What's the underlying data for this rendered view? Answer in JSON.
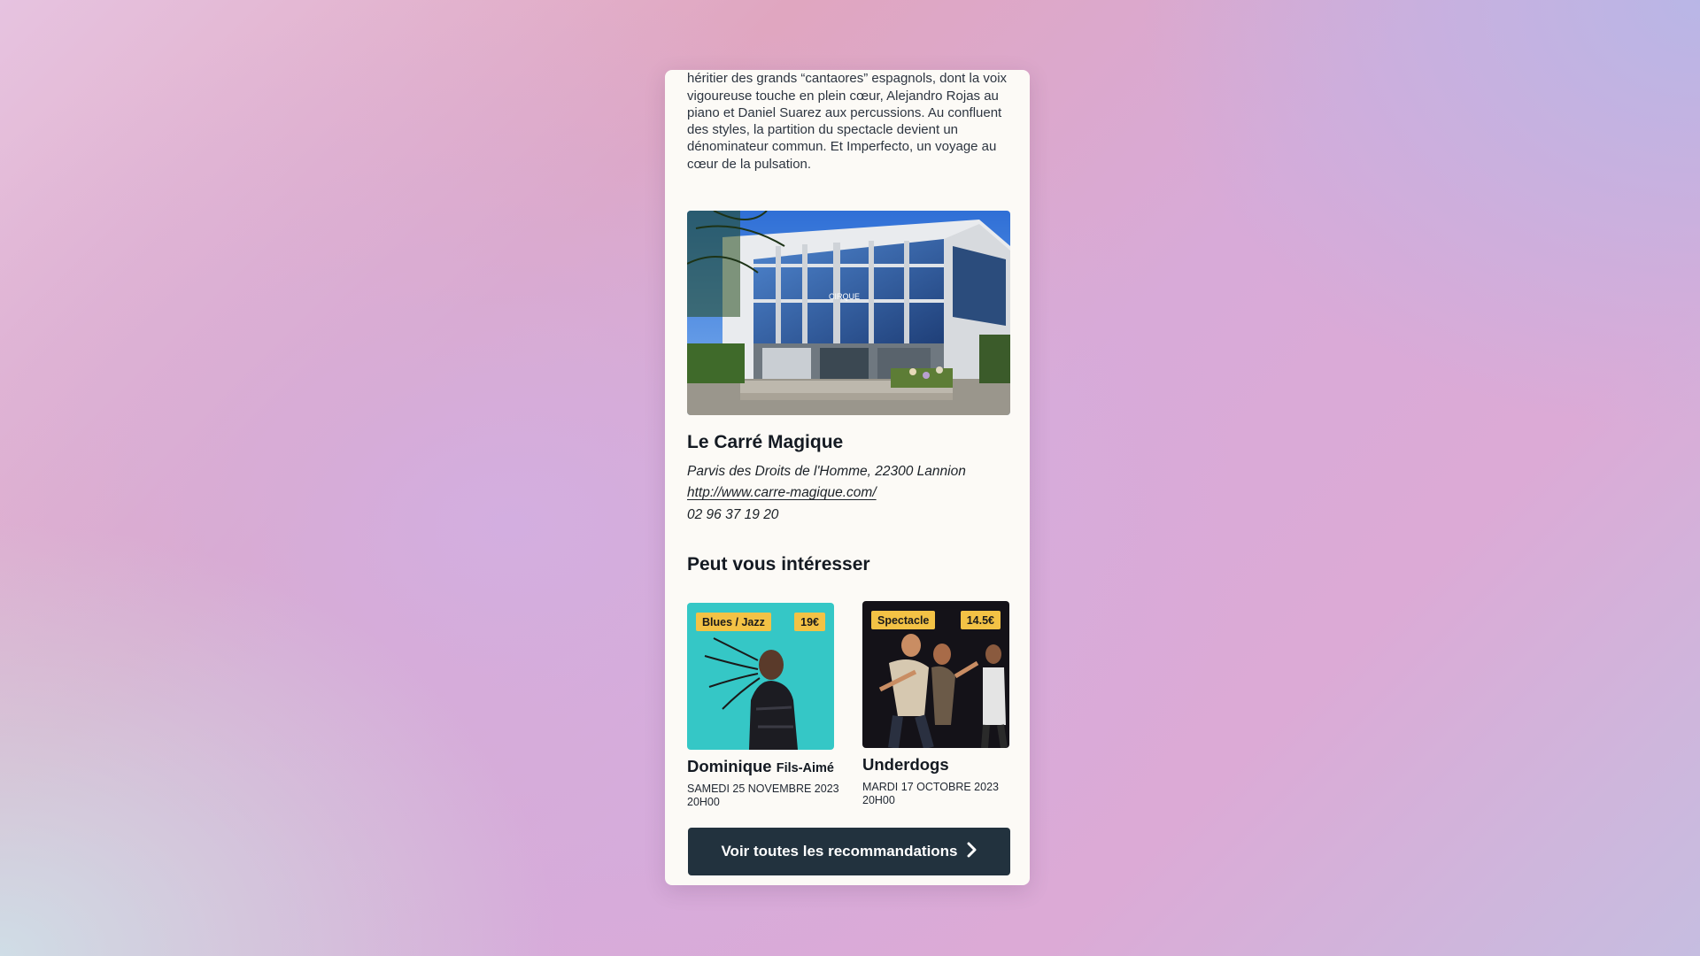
{
  "description": "transcendent cette complicité sur scène : David Lagos, héritier des grands “cantaores” espagnols, dont la voix vigoureuse touche en plein cœur, Alejandro Rojas au piano et Daniel Suarez aux percussions. Au confluent des styles, la partition du spectacle devient un dénominateur commun. Et Imperfecto, un voyage au cœur de la pulsation.",
  "venue": {
    "name": "Le Carré Magique",
    "address": "Parvis des Droits de l'Homme, 22300 Lannion",
    "website": "http://www.carre-magique.com/",
    "phone": "02 96 37 19 20",
    "photo_alt": "Le Carré Magique"
  },
  "recommendations": {
    "title": "Peut vous intéresser",
    "items": [
      {
        "category": "Blues / Jazz",
        "price": "19€",
        "title_main": "Dominique",
        "title_small": "Fils-Aimé",
        "date": "SAMEDI 25 NOVEMBRE 2023",
        "time": "20H00"
      },
      {
        "category": "Spectacle",
        "price": "14.5€",
        "title_main": "Underdogs",
        "title_small": "",
        "date": "MARDI 17 OCTOBRE 2023",
        "time": "20H00"
      }
    ],
    "cta_label": "Voir toutes les recommandations"
  },
  "colors": {
    "card_background": "#fcfaf6",
    "badge": "#f3c245",
    "cta_background": "#22323e",
    "heading_text": "#141a22"
  }
}
